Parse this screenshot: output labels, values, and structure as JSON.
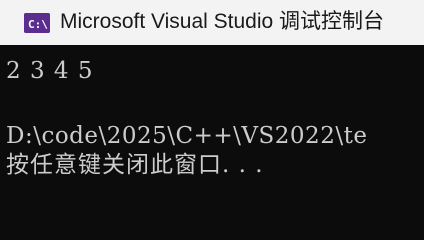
{
  "window": {
    "title": "Microsoft Visual Studio 调试控制台",
    "icon": "visual-studio-icon",
    "titlebar_color": "#f3f3f3",
    "icon_color": "#5c2d91"
  },
  "console": {
    "background": "#0c0c0c",
    "text_color": "#cccccc",
    "lines": [
      "2 3 4 5",
      "D:\\code\\2025\\C++\\VS2022\\te",
      "按任意键关闭此窗口. . ."
    ]
  }
}
